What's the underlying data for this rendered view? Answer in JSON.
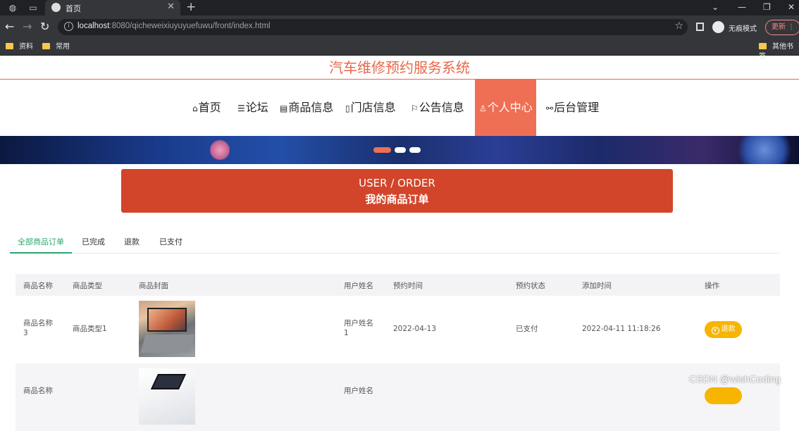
{
  "browser": {
    "tab_title": "首页",
    "url_host": "localhost",
    "url_rest": ":8080/qicheweixiuyuyuefuwu/front/index.html",
    "incognito_label": "无痕模式",
    "update_label": "更新",
    "bookmarks": [
      "资料",
      "常用",
      "其他书签"
    ]
  },
  "site": {
    "title": "汽车维修预约服务系统",
    "nav": [
      {
        "icon": "⌂",
        "label": "首页"
      },
      {
        "icon": "☰",
        "label": "论坛"
      },
      {
        "icon": "▤",
        "label": "商品信息"
      },
      {
        "icon": "▯",
        "label": "门店信息"
      },
      {
        "icon": "⚐",
        "label": "公告信息"
      },
      {
        "icon": "♙",
        "label": "个人中心"
      },
      {
        "icon": "⚯",
        "label": "后台管理"
      }
    ],
    "active_nav": "个人中心",
    "accent_color": "#ef6f55"
  },
  "order_banner": {
    "en": "USER / ORDER",
    "cn": "我的商品订单"
  },
  "subtabs": [
    "全部商品订单",
    "已完成",
    "退款",
    "已支付"
  ],
  "active_subtab": "全部商品订单",
  "table": {
    "headers": [
      "商品名称",
      "商品类型",
      "商品封面",
      "用户姓名",
      "预约时间",
      "预约状态",
      "添加时间",
      "操作"
    ],
    "rows": [
      {
        "name": "商品名称",
        "name2": "3",
        "type": "商品类型1",
        "user": "用户姓名",
        "user2": "1",
        "appoint_time": "2022-04-13",
        "status": "已支付",
        "added": "2022-04-11 11:18:26",
        "action": "退款"
      },
      {
        "name": "商品名称",
        "user": "用户姓名"
      }
    ]
  },
  "watermark": "CSDN @wishCoding"
}
